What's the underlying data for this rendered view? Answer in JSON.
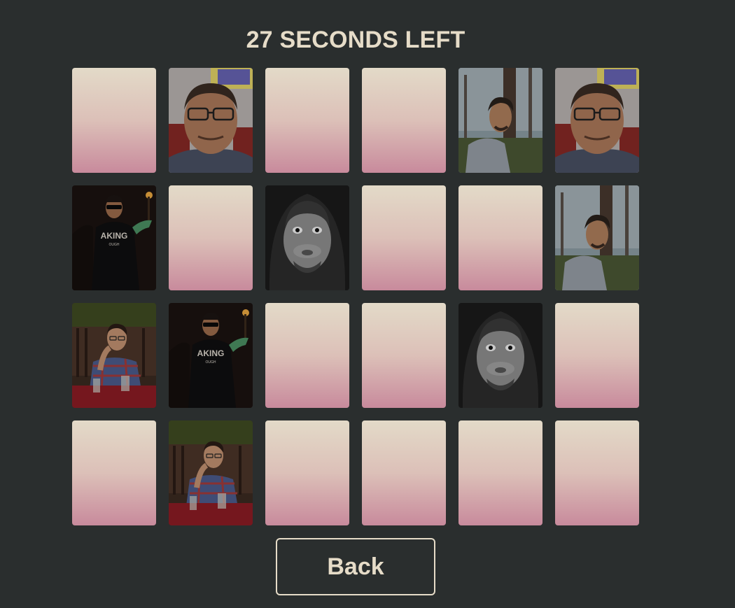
{
  "timer_text": "27 SECONDS LEFT",
  "back_button_label": "Back",
  "colors": {
    "background": "#2a2e2e",
    "text": "#e6dcc8",
    "card_back_top": "#e3dac8",
    "card_back_bottom": "#c88a9c"
  },
  "board": {
    "columns": 6,
    "rows": 4,
    "cards": [
      {
        "state": "hidden"
      },
      {
        "state": "revealed",
        "photo": "man-with-glasses-selfie"
      },
      {
        "state": "hidden"
      },
      {
        "state": "hidden"
      },
      {
        "state": "revealed",
        "photo": "man-in-park-grey-shirt"
      },
      {
        "state": "revealed",
        "photo": "man-with-glasses-selfie"
      },
      {
        "state": "revealed",
        "photo": "man-sunglasses-night"
      },
      {
        "state": "hidden"
      },
      {
        "state": "revealed",
        "photo": "man-hood-puffed-cheeks"
      },
      {
        "state": "hidden"
      },
      {
        "state": "hidden"
      },
      {
        "state": "revealed",
        "photo": "man-in-park-grey-shirt"
      },
      {
        "state": "revealed",
        "photo": "man-plaid-shirt-table"
      },
      {
        "state": "revealed",
        "photo": "man-sunglasses-night"
      },
      {
        "state": "hidden"
      },
      {
        "state": "hidden"
      },
      {
        "state": "revealed",
        "photo": "man-hood-puffed-cheeks"
      },
      {
        "state": "hidden"
      },
      {
        "state": "hidden"
      },
      {
        "state": "revealed",
        "photo": "man-plaid-shirt-table"
      },
      {
        "state": "hidden"
      },
      {
        "state": "hidden"
      },
      {
        "state": "hidden"
      },
      {
        "state": "hidden"
      }
    ]
  }
}
